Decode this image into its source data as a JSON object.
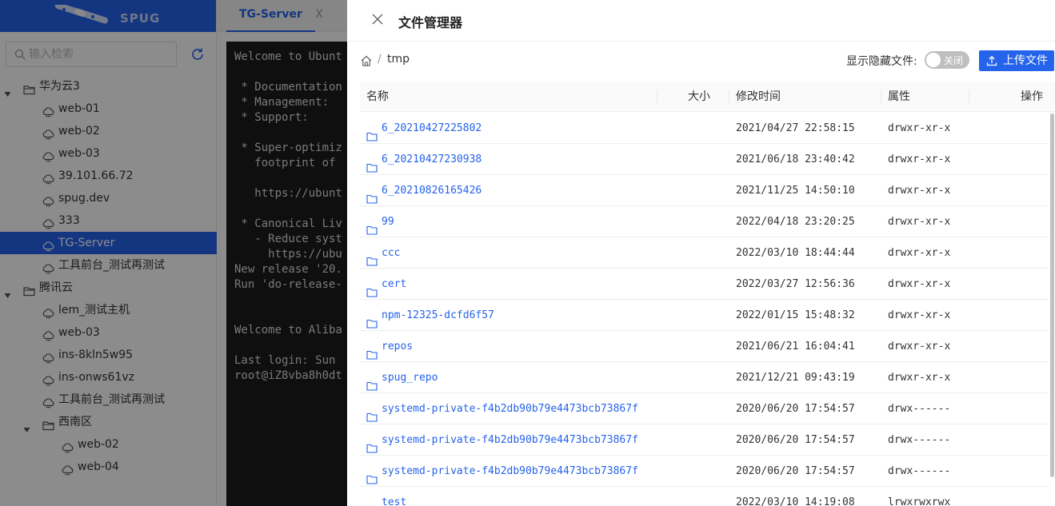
{
  "app": {
    "logo_text": "SPUG",
    "brand_color": "#2563eb"
  },
  "sidebar": {
    "search_placeholder": "输入检索",
    "tree": [
      {
        "type": "group",
        "label": "华为云3",
        "level": 0,
        "expanded": true
      },
      {
        "type": "host",
        "label": "web-01",
        "level": 1
      },
      {
        "type": "host",
        "label": "web-02",
        "level": 1
      },
      {
        "type": "host",
        "label": "web-03",
        "level": 1
      },
      {
        "type": "host",
        "label": "39.101.66.72",
        "level": 1
      },
      {
        "type": "host",
        "label": "spug.dev",
        "level": 1
      },
      {
        "type": "host",
        "label": "333",
        "level": 1
      },
      {
        "type": "host",
        "label": "TG-Server",
        "level": 1,
        "selected": true
      },
      {
        "type": "host",
        "label": "工具前台_测试再测试",
        "level": 1
      },
      {
        "type": "group",
        "label": "腾讯云",
        "level": 0,
        "expanded": true
      },
      {
        "type": "host",
        "label": "lem_测试主机",
        "level": 1
      },
      {
        "type": "host",
        "label": "web-03",
        "level": 1
      },
      {
        "type": "host",
        "label": "ins-8kln5w95",
        "level": 1
      },
      {
        "type": "host",
        "label": "ins-onws61vz",
        "level": 1
      },
      {
        "type": "host",
        "label": "工具前台_测试再测试",
        "level": 1
      },
      {
        "type": "group",
        "label": "西南区",
        "level": 1,
        "expanded": true
      },
      {
        "type": "host",
        "label": "web-02",
        "level": 2
      },
      {
        "type": "host",
        "label": "web-04",
        "level": 2
      }
    ]
  },
  "terminal": {
    "tab_label": "TG-Server",
    "tab_close": "X",
    "lines": [
      "Welcome to Ubunt",
      "",
      " * Documentation",
      " * Management:",
      " * Support:",
      "",
      " * Super-optimiz",
      "   footprint of",
      "",
      "   https://ubunt",
      "",
      " * Canonical Liv",
      "   - Reduce syst",
      "     https://ubu",
      "New release '20.",
      "Run 'do-release-",
      "",
      "",
      "Welcome to Aliba",
      "",
      "Last login: Sun",
      "root@iZ8vba8h0dt"
    ]
  },
  "drawer": {
    "title": "文件管理器",
    "breadcrumb_sep": "/",
    "current_dir": "tmp",
    "show_hidden_label": "显示隐藏文件:",
    "toggle_text": "关闭",
    "upload_label": "上传文件",
    "columns": {
      "name": "名称",
      "size": "大小",
      "mtime": "修改时间",
      "perm": "属性",
      "action": "操作"
    },
    "files": [
      {
        "name": "6_20210427225802",
        "size": "",
        "mtime": "2021/04/27 22:58:15",
        "perm": "drwxr-xr-x"
      },
      {
        "name": "6_20210427230938",
        "size": "",
        "mtime": "2021/06/18 23:40:42",
        "perm": "drwxr-xr-x"
      },
      {
        "name": "6_20210826165426",
        "size": "",
        "mtime": "2021/11/25 14:50:10",
        "perm": "drwxr-xr-x"
      },
      {
        "name": "99",
        "size": "",
        "mtime": "2022/04/18 23:20:25",
        "perm": "drwxr-xr-x"
      },
      {
        "name": "ccc",
        "size": "",
        "mtime": "2022/03/10 18:44:44",
        "perm": "drwxr-xr-x"
      },
      {
        "name": "cert",
        "size": "",
        "mtime": "2022/03/27 12:56:36",
        "perm": "drwxr-xr-x"
      },
      {
        "name": "npm-12325-dcfd6f57",
        "size": "",
        "mtime": "2022/01/15 15:48:32",
        "perm": "drwxr-xr-x"
      },
      {
        "name": "repos",
        "size": "",
        "mtime": "2021/06/21 16:04:41",
        "perm": "drwxr-xr-x"
      },
      {
        "name": "spug_repo",
        "size": "",
        "mtime": "2021/12/21 09:43:19",
        "perm": "drwxr-xr-x"
      },
      {
        "name": "systemd-private-f4b2db90b79e4473bcb73867f",
        "size": "",
        "mtime": "2020/06/20 17:54:57",
        "perm": "drwx------"
      },
      {
        "name": "systemd-private-f4b2db90b79e4473bcb73867f",
        "size": "",
        "mtime": "2020/06/20 17:54:57",
        "perm": "drwx------"
      },
      {
        "name": "systemd-private-f4b2db90b79e4473bcb73867f",
        "size": "",
        "mtime": "2020/06/20 17:54:57",
        "perm": "drwx------"
      },
      {
        "name": "test",
        "size": "",
        "mtime": "2022/03/10 14:19:08",
        "perm": "lrwxrwxrwx"
      }
    ]
  }
}
